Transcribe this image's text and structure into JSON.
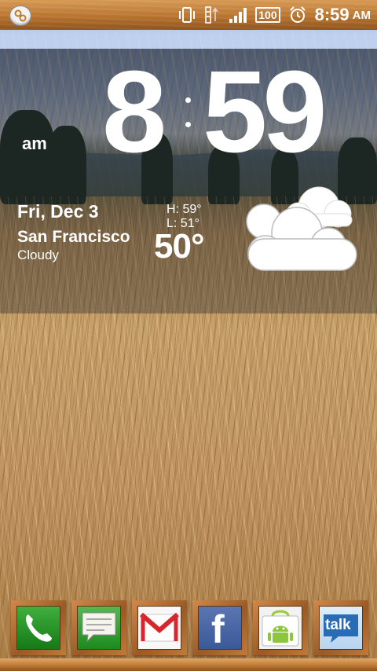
{
  "status_bar": {
    "time": "8:59",
    "ampm": "AM",
    "battery": "100",
    "icons": [
      "notification-icon",
      "vibrate-icon",
      "data-sync-icon",
      "signal-icon",
      "battery-icon",
      "alarm-icon"
    ]
  },
  "clock": {
    "hour": "8",
    "minute": "59",
    "ampm": "am"
  },
  "weather": {
    "date": "Fri, Dec 3",
    "city": "San Francisco",
    "condition": "Cloudy",
    "high": "H:  59°",
    "low": "L:  51°",
    "temp": "50°",
    "icon": "cloud-icon"
  },
  "dock": {
    "apps": [
      {
        "name": "Phone",
        "icon": "phone-icon"
      },
      {
        "name": "Messaging",
        "icon": "messaging-icon"
      },
      {
        "name": "Gmail",
        "icon": "gmail-icon"
      },
      {
        "name": "Facebook",
        "icon": "facebook-icon",
        "glyph": "f"
      },
      {
        "name": "Market",
        "icon": "android-market-icon"
      },
      {
        "name": "Talk",
        "icon": "talk-icon",
        "glyph": "talk"
      }
    ]
  },
  "colors": {
    "wood": "#b8742f",
    "phone_green": "#1f8e1f",
    "facebook_blue": "#3b5998",
    "talk_blue": "#2a6bb5"
  }
}
